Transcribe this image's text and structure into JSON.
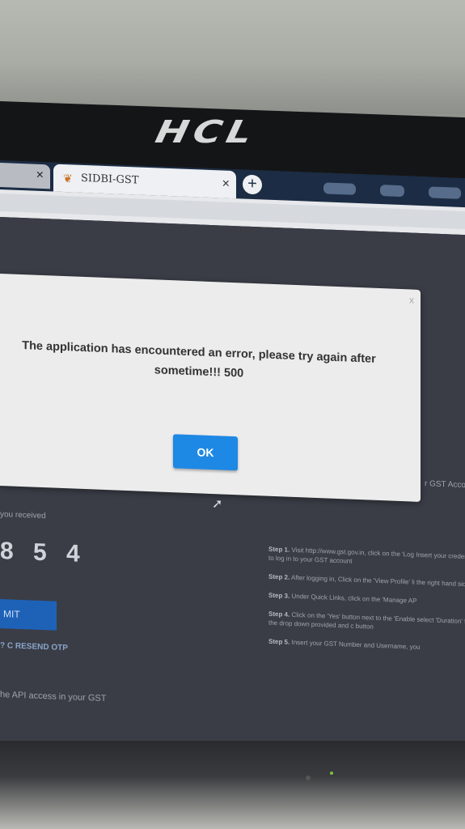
{
  "monitor": {
    "brand": "HCL"
  },
  "browser": {
    "tabs": [
      {
        "label": "",
        "close": "×"
      },
      {
        "label": "SIDBI-GST",
        "close": "×",
        "active": true
      }
    ],
    "new_tab": "+"
  },
  "dialog": {
    "close": "x",
    "message": "The application has encountered an error, please try again after sometime!!! 500",
    "ok_label": "OK"
  },
  "page": {
    "otp_label": "you received",
    "otp_digits": "8 5 4",
    "submit_label": "MIT",
    "resend_label": "? C RESEND OTP",
    "api_text": "he API access in your GST",
    "right_edge_text": "r GST Acco",
    "steps": [
      {
        "num": "Step 1.",
        "text": "Visit http://www.gst.gov.in, click on the 'Log Insert your credential to log in to your GST account"
      },
      {
        "num": "Step 2.",
        "text": "After logging in, Click on the 'View Profile' li the right hand side."
      },
      {
        "num": "Step 3.",
        "text": "Under Quick Links, click on the 'Manage AP"
      },
      {
        "num": "Step 4.",
        "text": "Click on the 'Yes' button next to the 'Enable select 'Duration' from the drop down provided and c button"
      },
      {
        "num": "Step 5.",
        "text": "Insert your GST Number and Username, you"
      }
    ]
  }
}
